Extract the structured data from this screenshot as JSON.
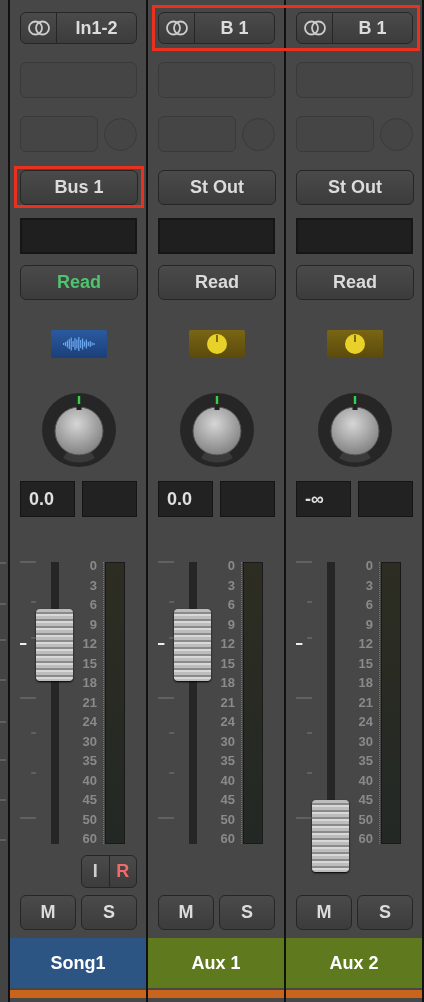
{
  "strips": [
    {
      "kind": "audio",
      "input": {
        "label": "In1-2",
        "highlighted": false
      },
      "output": {
        "label": "Bus 1",
        "highlighted": true
      },
      "automation": {
        "label": "Read",
        "active": true
      },
      "volume": "0.0",
      "fader": {
        "level": 0.7
      },
      "meter_scale": [
        "0",
        "3",
        "6",
        "9",
        "12",
        "15",
        "18",
        "21",
        "24",
        "30",
        "35",
        "40",
        "45",
        "50",
        "60"
      ],
      "input_monitor": {
        "label": "I",
        "on": false
      },
      "record": {
        "label": "R",
        "on": true
      },
      "mute": {
        "label": "M",
        "on": false
      },
      "solo": {
        "label": "S",
        "on": false
      },
      "name": "Song1",
      "color": "#2d5584"
    },
    {
      "kind": "aux",
      "input": {
        "label": "B 1",
        "highlighted": true
      },
      "output": {
        "label": "St Out",
        "highlighted": false
      },
      "automation": {
        "label": "Read",
        "active": false
      },
      "volume": "0.0",
      "fader": {
        "level": 0.7
      },
      "meter_scale": [
        "0",
        "3",
        "6",
        "9",
        "12",
        "15",
        "18",
        "21",
        "24",
        "30",
        "35",
        "40",
        "45",
        "50",
        "60"
      ],
      "mute": {
        "label": "M",
        "on": false
      },
      "solo": {
        "label": "S",
        "on": false
      },
      "name": "Aux 1",
      "color": "#5f7a1e"
    },
    {
      "kind": "aux",
      "input": {
        "label": "B 1",
        "highlighted": true
      },
      "output": {
        "label": "St Out",
        "highlighted": false
      },
      "automation": {
        "label": "Read",
        "active": false
      },
      "volume": "-∞",
      "fader": {
        "level": 0.02
      },
      "meter_scale": [
        "0",
        "3",
        "6",
        "9",
        "12",
        "15",
        "18",
        "21",
        "24",
        "30",
        "35",
        "40",
        "45",
        "50",
        "60"
      ],
      "mute": {
        "label": "M",
        "on": false
      },
      "solo": {
        "label": "S",
        "on": false
      },
      "name": "Aux 2",
      "color": "#5f7a1e"
    }
  ]
}
